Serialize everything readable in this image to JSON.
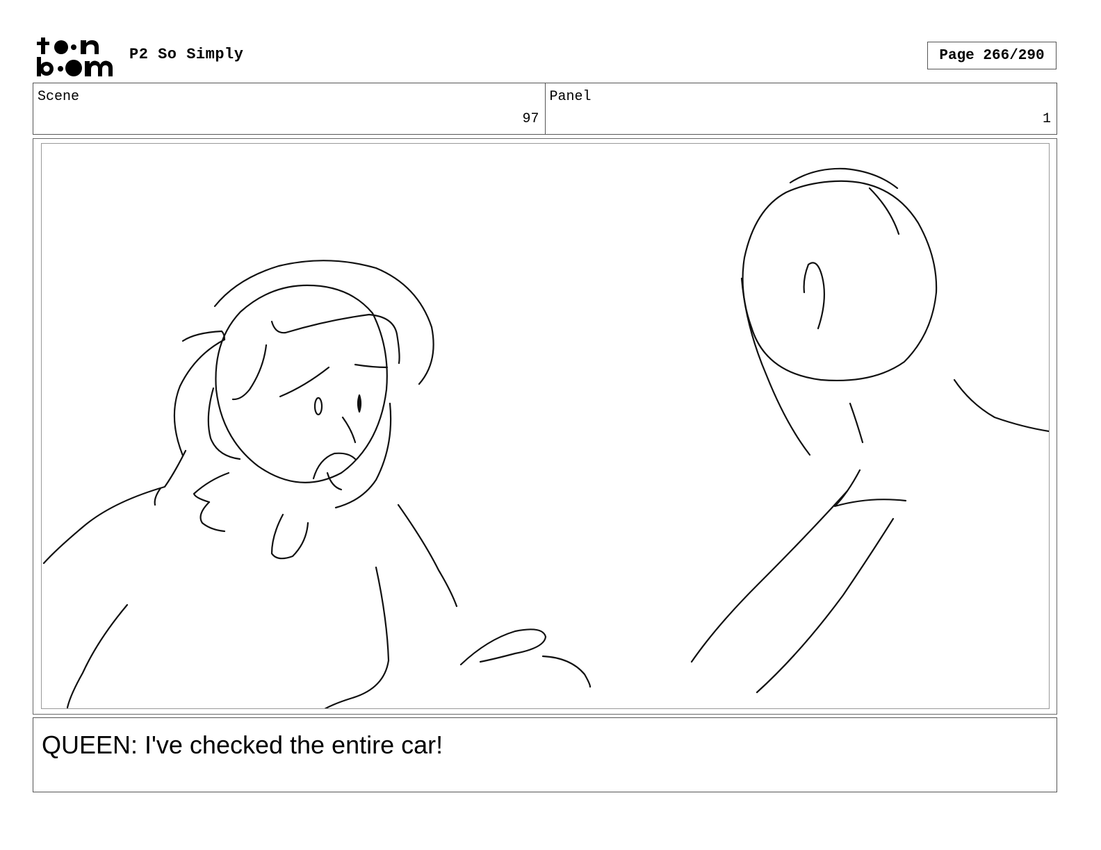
{
  "header": {
    "logo_line1": "toon",
    "logo_line2": "boom",
    "project_title": "P2 So Simply",
    "page_indicator": "Page 266/290"
  },
  "info": {
    "scene_label": "Scene",
    "scene_value": "97",
    "panel_label": "Panel",
    "panel_value": "1"
  },
  "dialogue": {
    "text": "QUEEN: I've checked the entire car!"
  }
}
